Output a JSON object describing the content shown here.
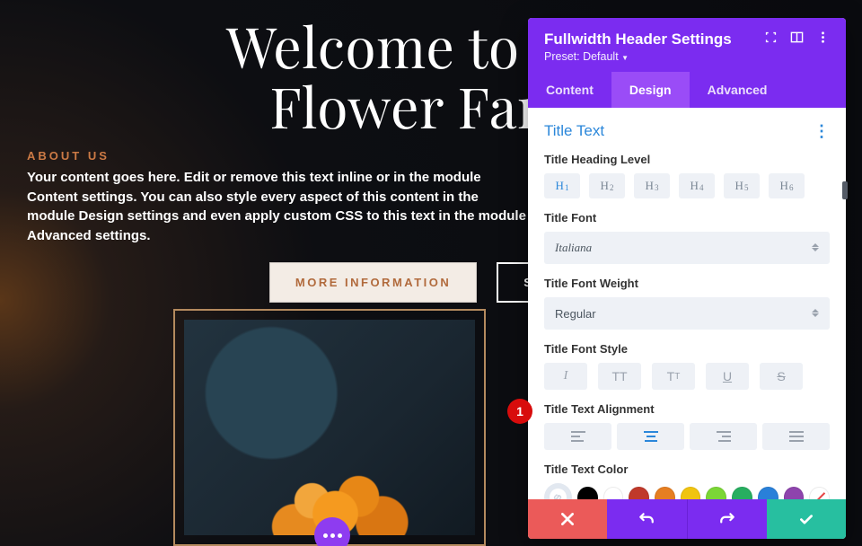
{
  "hero": {
    "title_line1": "Welcome to Divi",
    "title_line2": "Flower Farm"
  },
  "about": {
    "label": "ABOUT US",
    "body": "Your content goes here. Edit or remove this text inline or in the module Content settings. You can also style every aspect of this content in the module Design settings and even apply custom CSS to this text in the module Advanced settings."
  },
  "buttons": {
    "more": "MORE INFORMATION",
    "shop": "SHOP"
  },
  "panel": {
    "title": "Fullwidth Header Settings",
    "preset": "Preset: Default",
    "tabs": {
      "content": "Content",
      "design": "Design",
      "advanced": "Advanced",
      "active": "design"
    },
    "section": "Title Text",
    "fields": {
      "heading_level_label": "Title Heading Level",
      "heading_levels": [
        "H1",
        "H2",
        "H3",
        "H4",
        "H5",
        "H6"
      ],
      "heading_selected": "H1",
      "font_label": "Title Font",
      "font_value": "Italiana",
      "weight_label": "Title Font Weight",
      "weight_value": "Regular",
      "style_label": "Title Font Style",
      "align_label": "Title Text Alignment",
      "align_selected": "center",
      "color_label": "Title Text Color",
      "colors": [
        "active",
        "#000000",
        "#ffffff",
        "#c0392b",
        "#e67e22",
        "#f1c40f",
        "#7bd636",
        "#27ae60",
        "#2980d9",
        "#8e44ad",
        "none"
      ]
    }
  },
  "annotation": {
    "n1": "1"
  }
}
